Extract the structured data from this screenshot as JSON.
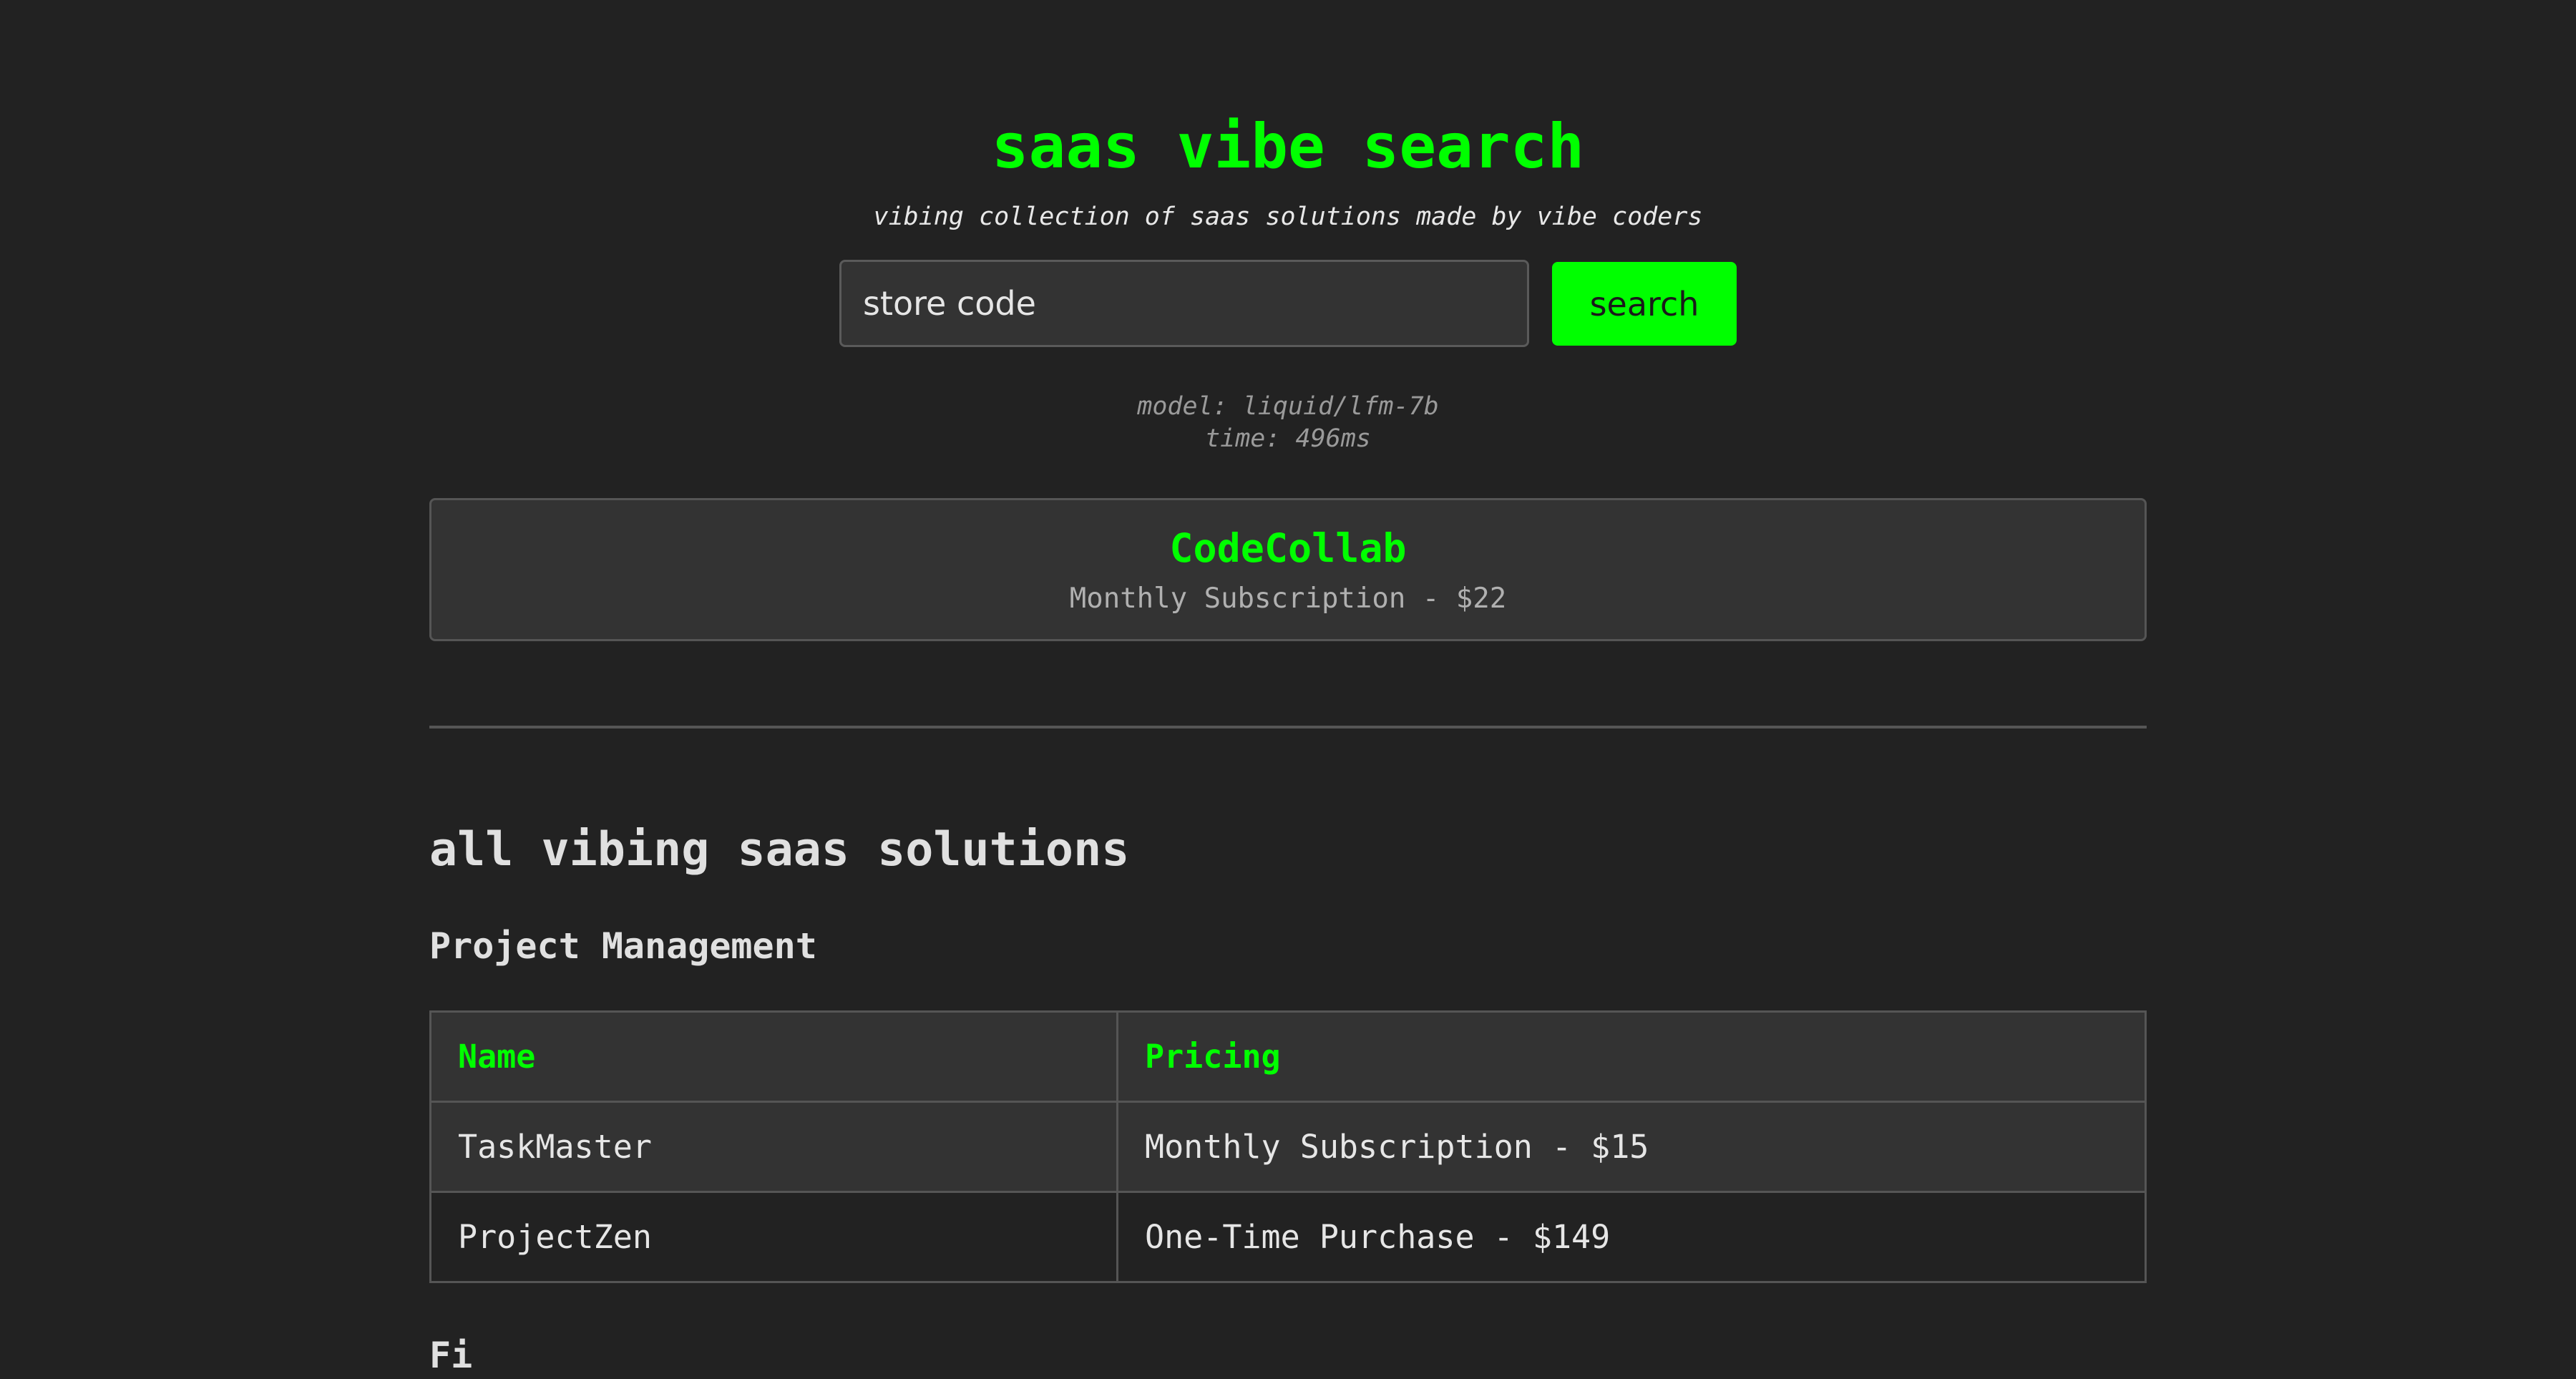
{
  "header": {
    "title": "saas vibe search",
    "subtitle": "vibing collection of saas solutions made by vibe coders"
  },
  "search": {
    "value": "store code",
    "button_label": "search"
  },
  "meta": {
    "model": "model: liquid/lfm-7b",
    "time": "time: 496ms"
  },
  "result": {
    "name": "CodeCollab",
    "pricing": "Monthly Subscription - $22"
  },
  "catalog": {
    "heading": "all vibing saas solutions",
    "categories": [
      {
        "name": "Project Management",
        "columns": [
          "Name",
          "Pricing"
        ],
        "rows": [
          {
            "name": "TaskMaster",
            "pricing": "Monthly Subscription - $15"
          },
          {
            "name": "ProjectZen",
            "pricing": "One-Time Purchase - $149"
          }
        ]
      },
      {
        "name": "Fi"
      }
    ]
  },
  "colors": {
    "background": "#222222",
    "accent": "#00ff00",
    "panel": "#333333",
    "border": "#555555"
  }
}
